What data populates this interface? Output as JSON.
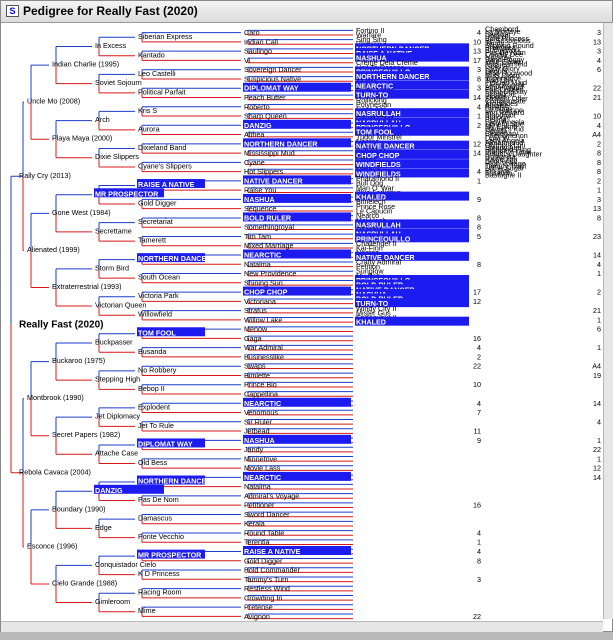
{
  "window": {
    "title": "Pedigree for Really Fast  (2020)"
  },
  "subject": "Really Fast  (2020)",
  "highlight_color": "#1c1cf0",
  "pedigree": {
    "g1": [
      "Rally Cry  (2013)",
      "Rebola Cavaca  (2004)"
    ],
    "g2": [
      "Uncle Mo  (2008)",
      "Alienated  (1999)",
      "Montbrook  (1990)",
      "Esconce  (1996)"
    ],
    "g3": [
      "Indian Charlie  (1995)",
      "Playa Maya  (2000)",
      "Gone West  (1984)",
      "Extraterrestrial  (1993)",
      "Buckaroo  (1975)",
      "Secret Papers  (1982)",
      "Boundary  (1990)",
      "Cielo Grande  (1988)"
    ],
    "g4": [
      "In Excess",
      "Soviet Sojourn",
      "Arch",
      "Dixie Slippers",
      "MR PROSPECTOR",
      "Secrettame",
      "Storm Bird",
      "Victorian Queen",
      "Buckpasser",
      "Stepping High",
      "Jet Diplomacy",
      "Attache Case",
      "DANZIG",
      "Edge",
      "Conquistador Cielo",
      "Gimleroom"
    ],
    "g5": [
      "Siberian Express",
      "Kantado",
      "Leo Castelli",
      "Political Parfait",
      "Kris S",
      "Aurora",
      "Dixieland Band",
      "Cyane's Slippers",
      "RAISE A NATIVE",
      "Gold Digger",
      "Secretariat",
      "Tamerett",
      "NORTHERN DANCER",
      "South Ocean",
      "Victoria Park",
      "Willowfield",
      "TOM FOOL",
      "Busanda",
      "No Robbery",
      "Bebop II",
      "Explodent",
      "Jet To Rule",
      "DIPLOMAT WAY",
      "Old Bess",
      "NORTHERN DANCER",
      "Pas De Nom",
      "Damascus",
      "Ponte Vecchio",
      "MR PROSPECTOR",
      "K D Princess",
      "Racing Room",
      "Mime"
    ],
    "g6": [
      "Caro",
      "Indian Call",
      "Saulingo",
      "Vi",
      "Sovereign Dancer",
      "Suspicious Native",
      "DIPLOMAT WAY",
      "Peach Butter",
      "Roberto",
      "Sharp Queen",
      "DANZIG",
      "Althea",
      "NORTHERN DANCER",
      "Mississippi Mud",
      "Cyane",
      "Hot Slippers",
      "NATIVE DANCER",
      "Raise You",
      "NASHUA",
      "Sequence",
      "BOLD RULER",
      "Somethingroyal",
      "Tim Tam",
      "Mixed Marriage",
      "NEARCTIC",
      "Natalma",
      "New Providence",
      "Shining Sun",
      "CHOP CHOP",
      "Victoriana",
      "Stratus",
      "Willow Lake",
      "Menow",
      "Gaga",
      "War Admiral",
      "Businesslike",
      "Swaps",
      "Bimlette",
      "Prince Bio",
      "Cappellina",
      "NEARCTIC",
      "Venomous",
      "Sir Ruler",
      "Jetbead",
      "NASHUA",
      "Jandy",
      "Minnetrive",
      "Movie Lass",
      "NEARCTIC",
      "Natalma",
      "Admiral's Voyage",
      "Petitioner",
      "Sword Dancer",
      "Kerala",
      "Round Table",
      "Terentia",
      "RAISE A NATIVE",
      "Gold Digger",
      "Bold Commander",
      "Tammy's Turn",
      "Restless Wind",
      "Crowding In",
      "Pretense",
      "Avignon"
    ],
    "g7": [
      "Fortino II",
      "Warfare",
      "Sing Sing",
      "Vilmorin",
      "NORTHERN DANCER",
      "RAISE A NATIVE",
      "NASHUA",
      "Creme Dela Creme",
      "Hail To Reason",
      "PRINCEQUILLO",
      "NORTHERN DANCER",
      "Alydar",
      "NEARCTIC",
      "Delta Judge",
      "TURN-TO",
      "Rollicking",
      "Polynesian",
      "Case Ace",
      "NASRULLAH",
      "Count Fleet",
      "NASRULLAH",
      "PRINCEQUILLO",
      "TOM FOOL",
      "Tudor Minstrel",
      "Nearco",
      "NATIVE DANCER",
      "Bull Page",
      "CHOP CHOP",
      "Flares",
      "WINDFIELDS",
      "Nimbus",
      "WINDFIELDS",
      "Pharamond II",
      "Bull Dog",
      "Man O' War",
      "Blue Larkspur",
      "KHALED",
      "Bimelech",
      "Prince Rose",
      "Le Capucin",
      "Nearco",
      "Mel Hash",
      "NASRULLAH",
      "Olympia",
      "NASRULLAH",
      "PRINCEQUILLO",
      "Challenger II",
      "Kai-Finn",
      "Nearco",
      "NATIVE DANCER",
      "Crafty Admiral",
      "Petition",
      "Sunglow",
      "My Babu",
      "PRINCEQUILLO",
      "BOLD RULER",
      "NATIVE DANCER",
      "NASHUA",
      "BOLD RULER",
      "TURN-TO",
      "Windy City II",
      "Mister Gus",
      "Endeavour II",
      "KHALED"
    ],
    "g7_num": [
      "4",
      "10",
      "13",
      "17",
      "3",
      "8",
      "3",
      "14",
      "4",
      "1",
      "2",
      "",
      "12",
      "14",
      "",
      "4",
      "1",
      "",
      "9",
      "",
      "8",
      "8",
      "5",
      "",
      "",
      "8",
      "",
      "",
      "17",
      "12",
      "",
      "",
      "",
      "16",
      "4",
      "2",
      "22",
      "",
      "10",
      "",
      "4",
      "7",
      "",
      "11",
      "9",
      "",
      "",
      "",
      "",
      "",
      "",
      "16",
      "",
      "",
      "4",
      "1",
      "4",
      "8",
      "",
      "3",
      "",
      "",
      "",
      "22"
    ],
    "g8": [
      "Chambord",
      "La Morlaye",
      "Saulisa",
      "Dotterel",
      "Bold Princess",
      "Be Suspicious",
      "Jandy",
      "Slipping Round",
      "Bramalea",
      "Bridgework",
      "Pas De Nom",
      "Courtly Dee",
      "Natalma",
      "Sand Buggy",
      "Your Game",
      "Miss Fairfield",
      "Geisha",
      "Lady Glory",
      "Segula",
      "Miss Dogwood",
      "Miss Disco",
      "Imperatrice",
      "Two Lea",
      "Persian Maid",
      "Lady Angela",
      "Almahmoud",
      "Fair Colleen",
      "Solar Display",
      "Sceptical",
      "Iribelle",
      "Straight Offer",
      "Compensate",
      "Alcibiades",
      "Alpoise",
      "Brushup",
      "La Troienne",
      "Iron Reward",
      "Bloodroot",
      "Biologie",
      "Bellina",
      "Lady Angela",
      "Spiteful Sue",
      "My Emma",
      "Harriet's Kid",
      "Segula",
      "Centenary",
      "Phenomenon",
      "Dora W",
      "Lady Angela",
      "Almahmoud",
      "Olympia Lou",
      "Steady Aim",
      "Highland Fling",
      "Blade Of Time",
      "Knight's Daughter",
      "Romanita",
      "Raise You",
      "Sequence",
      "High Voltage",
      "Tammy Twist",
      "Lump Sugar",
      "Pin Oak",
      "Imitation",
      "Bastogne II"
    ],
    "g8_num": [
      "3",
      "13",
      "3",
      "4",
      "6",
      "",
      "22",
      "21",
      "",
      "10",
      "4",
      "A4",
      "2",
      "8",
      "8",
      "8",
      "2",
      "1",
      "3",
      "13",
      "8",
      "",
      "23",
      "",
      "14",
      "4",
      "1",
      "",
      "2",
      "",
      "21",
      "1",
      "6",
      "",
      "1",
      "",
      "A4",
      "19",
      "",
      "",
      "14",
      "",
      "4",
      "",
      "1",
      "22",
      "1",
      "12",
      "14",
      "",
      "",
      "",
      "",
      "",
      "",
      "",
      "",
      "",
      "",
      "",
      "",
      "",
      "",
      ""
    ]
  }
}
